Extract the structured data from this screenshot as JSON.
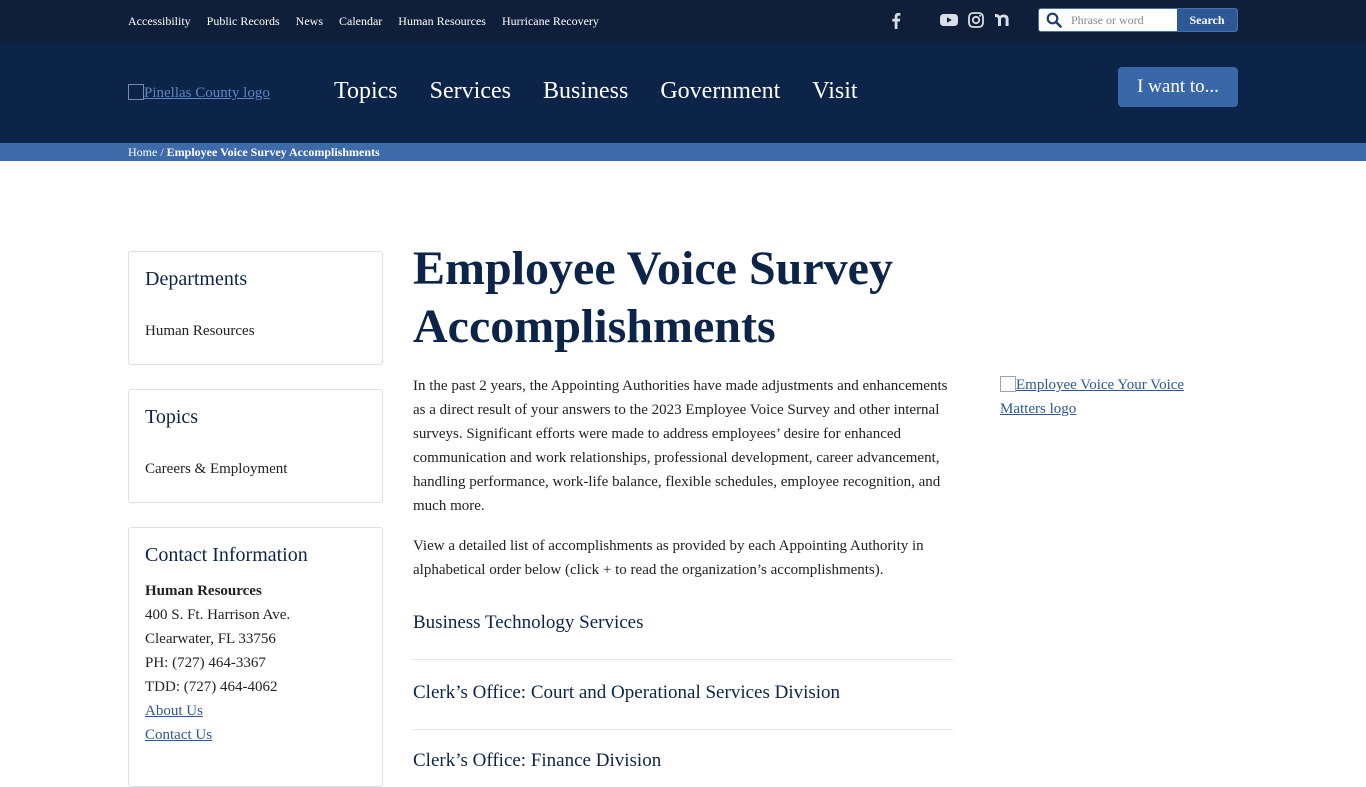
{
  "utility": {
    "links": [
      "Accessibility",
      "Public Records",
      "News",
      "Calendar",
      "Human Resources",
      "Hurricane Recovery"
    ],
    "social": [
      "facebook-icon",
      "youtube-icon",
      "instagram-icon",
      "nextdoor-icon"
    ],
    "search": {
      "placeholder": "Phrase or word",
      "button": "Search"
    }
  },
  "header": {
    "logo_alt": "Pinellas County logo",
    "nav": [
      "Topics",
      "Services",
      "Business",
      "Government",
      "Visit"
    ],
    "iwant": "I want to..."
  },
  "breadcrumb": {
    "home": "Home",
    "separator": " / ",
    "current": "Employee Voice Survey Accomplishments"
  },
  "sidebar": {
    "departments": {
      "title": "Departments",
      "items": [
        "Human Resources"
      ]
    },
    "topics": {
      "title": "Topics",
      "items": [
        "Careers & Employment"
      ]
    },
    "contact": {
      "title": "Contact Information",
      "name": "Human Resources",
      "lines": [
        "400 S. Ft. Harrison Ave.",
        "Clearwater, FL 33756",
        "PH: (727) 464-3367",
        "TDD: (727) 464-4062"
      ],
      "links": [
        "About Us",
        "Contact Us"
      ]
    }
  },
  "main": {
    "title": "Employee Voice Survey Accomplishments",
    "paragraph1": "In the past 2 years, the Appointing Authorities have made adjustments and enhancements as a direct result of your answers to the 2023 Employee Voice Survey and other internal surveys. Significant efforts were made to address employees’ desire for enhanced communication and work relationships, professional development, career advancement, handling performance, work-life balance, flexible schedules, employee recognition, and much more.",
    "paragraph2": "View a detailed list of accomplishments as provided by each Appointing Authority in alphabetical order below (click + to read the organization’s accomplishments).",
    "accordion": [
      "Business Technology Services",
      "Clerk’s Office: Court and Operational Services Division",
      "Clerk’s Office: Finance Division"
    ]
  },
  "side_image": {
    "alt": "Employee Voice Your Voice Matters logo"
  },
  "colors": {
    "utility_bg": "#0f1f3a",
    "header_bg": "#0d2449",
    "breadcrumb_bg": "#3d6aa9",
    "accent": "#2c5896"
  }
}
